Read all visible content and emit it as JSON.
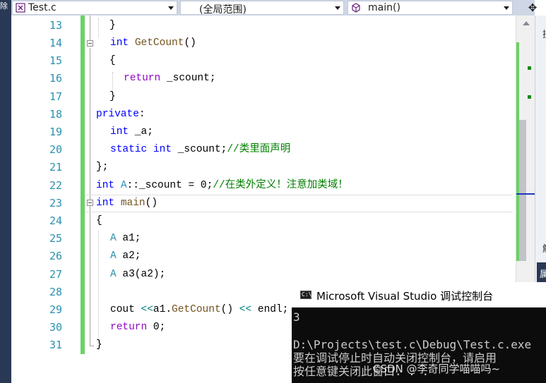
{
  "navbar": {
    "file_combo": "Test.c",
    "scope_combo": "(全局范围)",
    "member_combo": "main()"
  },
  "left_strip_glyph": "除",
  "editor": {
    "lines": [
      {
        "n": "13"
      },
      {
        "n": "14"
      },
      {
        "n": "15"
      },
      {
        "n": "16"
      },
      {
        "n": "17"
      },
      {
        "n": "18"
      },
      {
        "n": "19"
      },
      {
        "n": "20"
      },
      {
        "n": "21"
      },
      {
        "n": "22"
      },
      {
        "n": "23"
      },
      {
        "n": "24"
      },
      {
        "n": "25"
      },
      {
        "n": "26"
      },
      {
        "n": "27"
      },
      {
        "n": "28"
      },
      {
        "n": "29"
      },
      {
        "n": "30"
      },
      {
        "n": "31"
      }
    ],
    "tokens": {
      "l13_brace": "}",
      "l14_int": "int",
      "l14_fn": "GetCount",
      "l14_paren": "()",
      "l15_brace": "{",
      "l16_return": "return",
      "l16_rest": " _scount;",
      "l17_brace": "}",
      "l18_private": "private",
      "l18_colon": ":",
      "l19_int": "int",
      "l19_rest": " _a;",
      "l20_static": "static",
      "l20_int": "int",
      "l20_rest": " _scount;",
      "l20_comment": "//类里面声明",
      "l21_close": "};",
      "l22_int": "int",
      "l22_A": "A",
      "l22_rest": "::_scount = 0;",
      "l22_comment": "//在类外定义！注意加类域！",
      "l23_int": "int",
      "l23_main": "main",
      "l23_paren": "()",
      "l24_brace": "{",
      "l25_A": "A",
      "l25_rest": " a1;",
      "l26_A": "A",
      "l26_rest": " a2;",
      "l27_A": "A",
      "l27_rest": " a3(a2);",
      "l29_cout": "cout",
      "l29_op1": " <<",
      "l29_a1": "a1.",
      "l29_fn": "GetCount",
      "l29_paren": "()",
      "l29_op2": " <<",
      "l29_endl": " endl;",
      "l30_return": "return",
      "l30_rest": " 0;",
      "l31_brace": "}"
    }
  },
  "right_panel": {
    "t1": "搜",
    "t2": "解",
    "t3": "属"
  },
  "console": {
    "title": "Microsoft Visual Studio 调试控制台",
    "icon_label": "C:\\",
    "lines": [
      "3",
      "",
      "D:\\Projects\\test.c\\Debug\\Test.c.exe",
      "要在调试停止时自动关闭控制台，请启用",
      "按任意键关闭此窗口. . ."
    ]
  },
  "watermark": "CSDN @李奇同学喵喵吗~"
}
